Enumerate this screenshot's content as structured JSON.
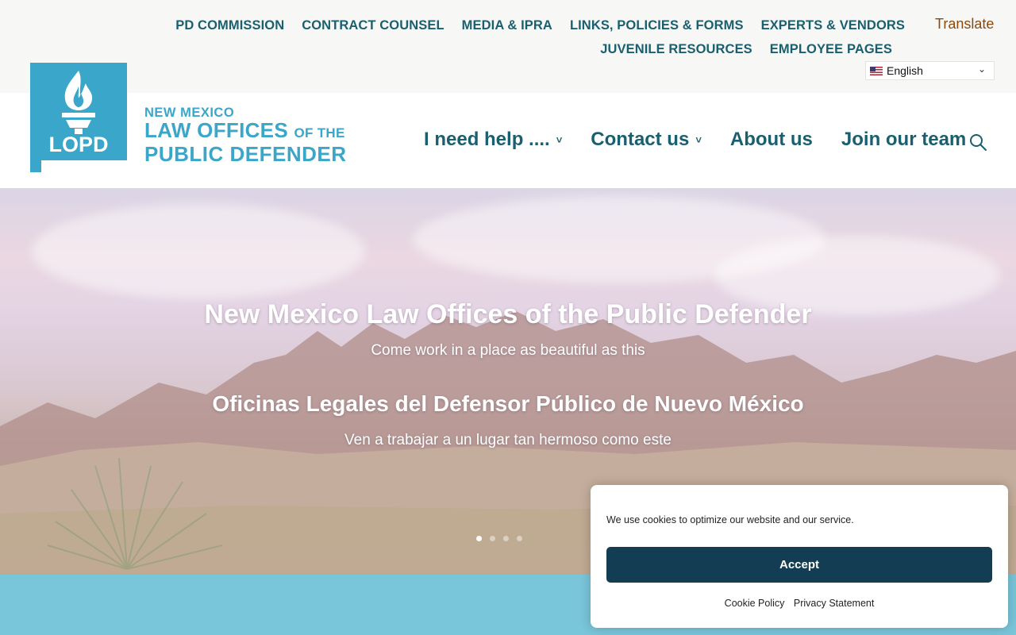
{
  "util_nav": {
    "items": [
      {
        "label": "PD COMMISSION"
      },
      {
        "label": "CONTRACT COUNSEL"
      },
      {
        "label": "MEDIA & IPRA"
      },
      {
        "label": "LINKS, POLICIES & FORMS"
      },
      {
        "label": "EXPERTS & VENDORS"
      },
      {
        "label": "JUVENILE RESOURCES"
      },
      {
        "label": "EMPLOYEE PAGES"
      }
    ]
  },
  "translate": {
    "label": "Translate",
    "language": "English"
  },
  "logo": {
    "mark_text": "LOPD",
    "line1": "NEW MEXICO",
    "line2_main": "LAW OFFICES",
    "line2_small": "OF THE",
    "line3": "PUBLIC DEFENDER"
  },
  "main_nav": {
    "items": [
      {
        "label": "I need help ....",
        "has_dropdown": true
      },
      {
        "label": "Contact us",
        "has_dropdown": true
      },
      {
        "label": "About us",
        "has_dropdown": false
      },
      {
        "label": "Join our team",
        "has_dropdown": false
      }
    ]
  },
  "hero": {
    "title_en": "New Mexico Law Offices of the Public Defender",
    "subtitle_en": "Come work in a place as beautiful as this",
    "title_es": "Oficinas Legales del Defensor Público de Nuevo México",
    "subtitle_es": "Ven a trabajar a un lugar tan hermoso como este",
    "slide_count": 4,
    "active_slide": 1
  },
  "cookie": {
    "message": "We use cookies to optimize our website and our service.",
    "accept_label": "Accept",
    "policy_link": "Cookie Policy",
    "privacy_link": "Privacy Statement"
  },
  "colors": {
    "brand_teal": "#1a5f6f",
    "logo_blue": "#3aa6c9",
    "translate_orange": "#8a4a0e",
    "accept_button": "#123d52",
    "band": "#79c5da"
  },
  "icons": {
    "search": "search-icon",
    "dropdown": "chevron-down-icon",
    "flag": "us-flag-icon"
  }
}
